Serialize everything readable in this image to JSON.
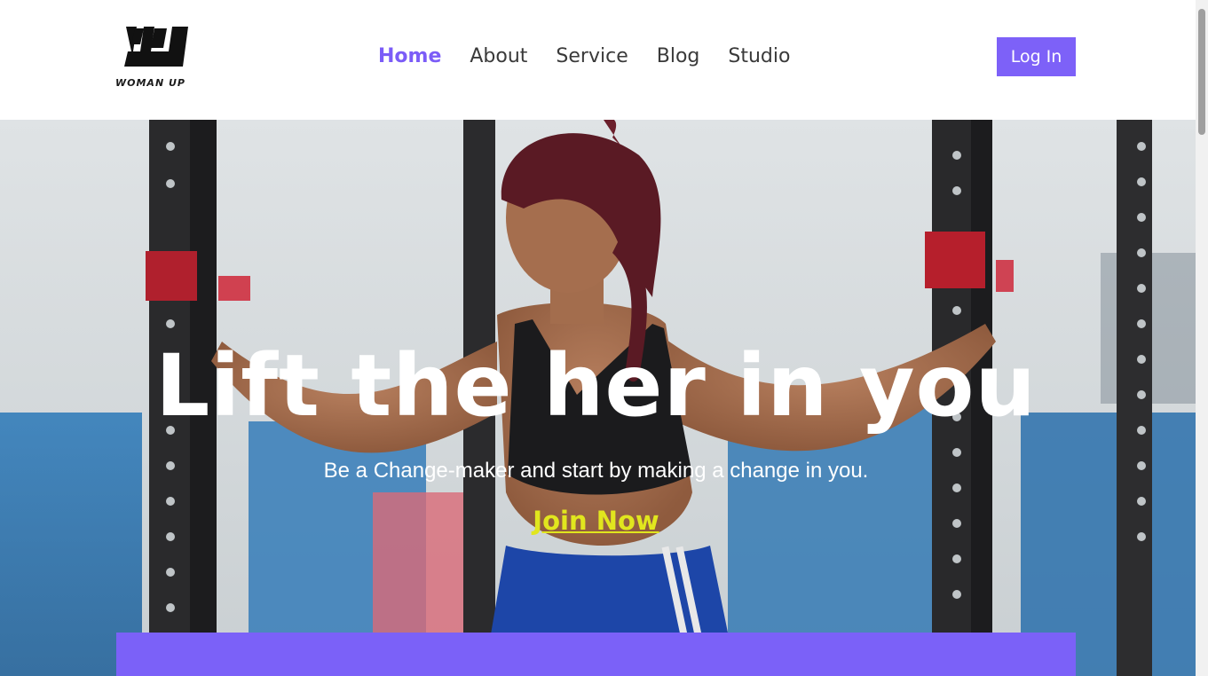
{
  "brand": {
    "name": "WOMAN UP",
    "logo_icon": "wu-logo-icon"
  },
  "nav": {
    "items": [
      {
        "label": "Home",
        "active": true
      },
      {
        "label": "About",
        "active": false
      },
      {
        "label": "Service",
        "active": false
      },
      {
        "label": "Blog",
        "active": false
      },
      {
        "label": "Studio",
        "active": false
      }
    ],
    "login_label": "Log In"
  },
  "hero": {
    "title": "Lift the her in you",
    "subtitle": "Be a Change-maker and start by making a change in you.",
    "cta_label": "Join Now"
  },
  "colors": {
    "accent": "#7b5cf7",
    "button": "#7d61f8",
    "cta": "#e1e61e",
    "panel": "#7b61f8"
  }
}
